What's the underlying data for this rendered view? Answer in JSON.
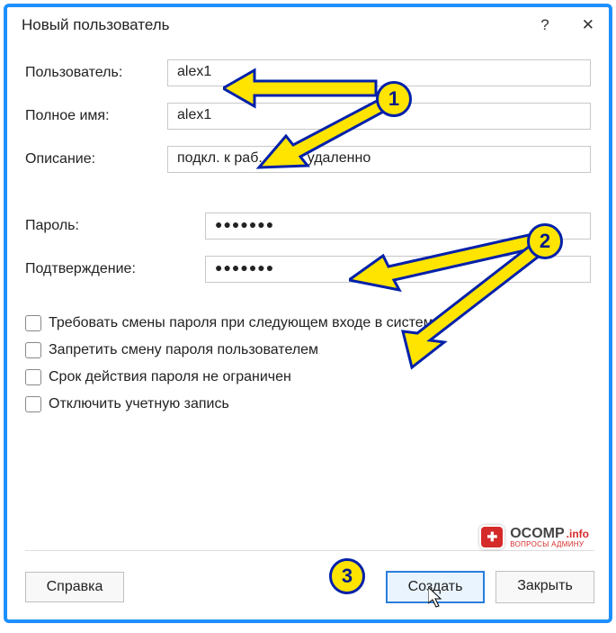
{
  "titlebar": {
    "title": "Новый пользователь",
    "help": "?",
    "close": "✕"
  },
  "fields": {
    "user_label": "Пользователь:",
    "user_value": "alex1",
    "fullname_label": "Полное имя:",
    "fullname_value": "alex1",
    "description_label": "Описание:",
    "description_value": "подкл. к раб. столу удаленно",
    "password_label": "Пароль:",
    "password_value": "●●●●●●●",
    "confirm_label": "Подтверждение:",
    "confirm_value": "●●●●●●●"
  },
  "checkboxes": {
    "c1": "Требовать смены пароля при следующем входе в систему",
    "c2": "Запретить смену пароля пользователем",
    "c3": "Срок действия пароля не ограничен",
    "c4": "Отключить учетную запись"
  },
  "buttons": {
    "help": "Справка",
    "create": "Создать",
    "close": "Закрыть"
  },
  "callouts": {
    "n1": "1",
    "n2": "2",
    "n3": "3"
  },
  "watermark": {
    "badge": "✚",
    "main": "OCOMP",
    "suffix": ".info",
    "sub": "ВОПРОСЫ АДМИНУ"
  }
}
